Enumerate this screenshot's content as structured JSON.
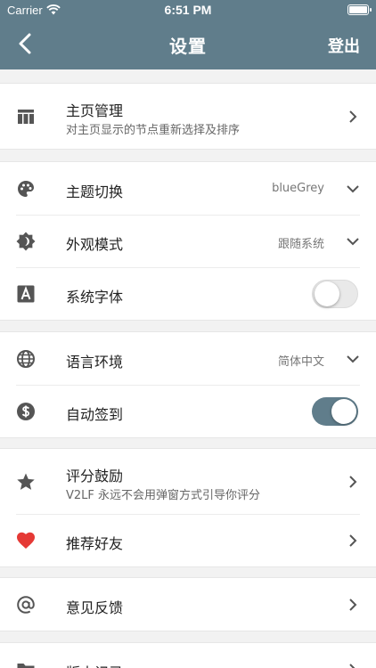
{
  "status_bar": {
    "carrier": "Carrier",
    "time": "6:51 PM"
  },
  "header": {
    "title": "设置",
    "action": "登出"
  },
  "colors": {
    "appbar": "#607d8b",
    "icon": "#555555",
    "heart": "#e53935",
    "toggle_on": "#607d8b"
  },
  "groups": [
    {
      "items": [
        {
          "label": "主页管理",
          "sub": "对主页显示的节点重新选择及排序",
          "icon": "table-icon",
          "control": "chevron-right"
        }
      ]
    },
    {
      "items": [
        {
          "label": "主题切换",
          "value": "blueGrey",
          "icon": "palette-icon",
          "control": "chevron-down"
        },
        {
          "label": "外观模式",
          "value": "跟随系统",
          "icon": "brightness-icon",
          "control": "chevron-down"
        },
        {
          "label": "系统字体",
          "icon": "font-icon",
          "control": "toggle",
          "on": false
        }
      ]
    },
    {
      "items": [
        {
          "label": "语言环境",
          "value": "简体中文",
          "icon": "globe-icon",
          "control": "chevron-down"
        },
        {
          "label": "自动签到",
          "icon": "dollar-icon",
          "control": "toggle",
          "on": true
        }
      ]
    },
    {
      "items": [
        {
          "label": "评分鼓励",
          "sub": "V2LF 永远不会用弹窗方式引导你评分",
          "icon": "star-icon",
          "control": "chevron-right"
        },
        {
          "label": "推荐好友",
          "icon": "heart-icon",
          "control": "chevron-right"
        }
      ]
    },
    {
      "items": [
        {
          "label": "意见反馈",
          "icon": "at-icon",
          "control": "chevron-right"
        }
      ]
    },
    {
      "items": [
        {
          "label": "版本记录",
          "icon": "folder-icon",
          "control": "chevron-right"
        }
      ]
    }
  ]
}
